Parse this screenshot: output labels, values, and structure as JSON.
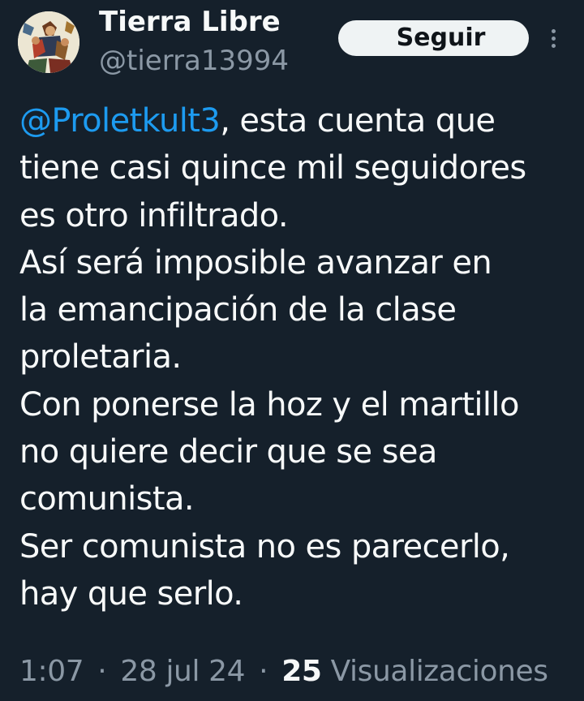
{
  "profile": {
    "display_name": "Tierra Libre",
    "handle": "@tierra13994",
    "avatar_icon": "illustrated-figures-avatar"
  },
  "header": {
    "follow_label": "Seguir",
    "more_icon": "more-vertical-icon"
  },
  "tweet": {
    "mention": "@Proletkult3",
    "lines": [
      ", esta cuenta que",
      "tiene casi quince mil seguidores",
      "es otro infiltrado.",
      "Así será imposible avanzar en",
      "la emancipación de la clase",
      "proletaria.",
      "Con ponerse la hoz y el martillo",
      "no quiere decir que se sea",
      "comunista.",
      "Ser comunista no es parecerlo,",
      "hay que serlo."
    ]
  },
  "meta": {
    "time": "1:07",
    "separator": "·",
    "date": "28 jul 24",
    "views_count": "25",
    "views_label": "Visualizaciones"
  },
  "colors": {
    "background": "#15202b",
    "text": "#f7f9f9",
    "secondary": "#8b98a5",
    "link": "#1d9bf0",
    "button_bg": "#eff3f4"
  }
}
